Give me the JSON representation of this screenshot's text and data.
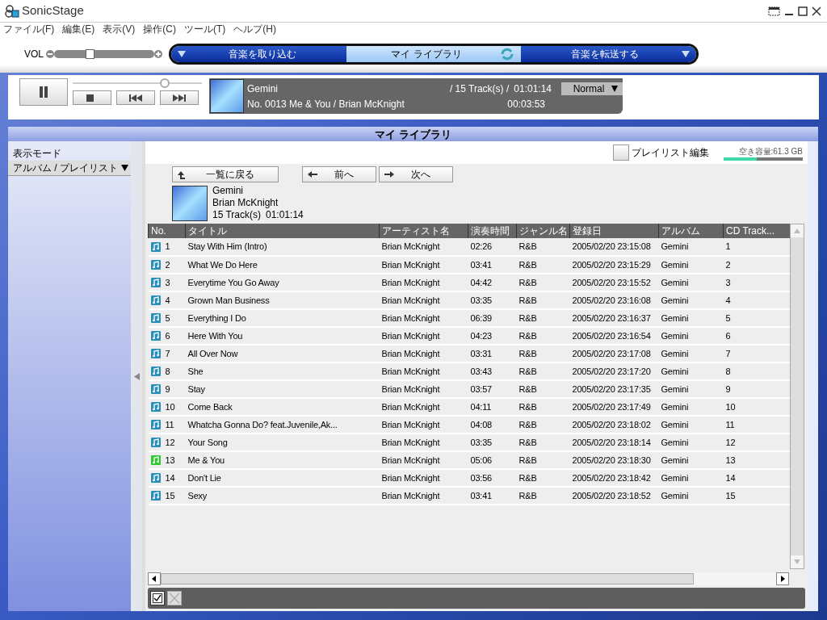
{
  "window": {
    "title": "SonicStage"
  },
  "menu": [
    "ファイル(F)",
    "編集(E)",
    "表示(V)",
    "操作(C)",
    "ツール(T)",
    "ヘルプ(H)"
  ],
  "volume": {
    "label": "VOL",
    "level": 0.35
  },
  "mode_tabs": [
    {
      "label": "音楽を取り込む",
      "selected": false
    },
    {
      "label": "マイ ライブラリ",
      "selected": true
    },
    {
      "label": "音楽を転送する",
      "selected": false
    }
  ],
  "player": {
    "seek": {
      "level": 0.73
    },
    "album": "Gemini",
    "track_count": "/ 15 Track(s)  /",
    "total_time": "01:01:14",
    "now_playing": "No. 0013   Me & You / Brian McKnight",
    "elapsed": "00:03:53",
    "play_mode": "Normal"
  },
  "library": {
    "title": "マイ ライブラリ",
    "view_mode_label": "表示モード",
    "view_mode": "アルバム / プレイリスト",
    "playlist_edit": {
      "label": "プレイリスト編集",
      "checked": false
    },
    "free_space": {
      "label": "空き容量:61.3 GB",
      "level": 0.42
    },
    "nav_buttons": [
      {
        "kind": "up",
        "label": "一覧に戻る"
      },
      {
        "kind": "back",
        "label": "前へ"
      },
      {
        "kind": "forward",
        "label": "次へ"
      }
    ],
    "album": {
      "title": "Gemini",
      "artist": "Brian McKnight",
      "tracks": "15 Track(s)",
      "duration": "01:01:14"
    },
    "table": {
      "columns": [
        "No.",
        "タイトル",
        "アーティスト名",
        "演奏時間",
        "ジャンル名",
        "登録日",
        "アルバム",
        "CD Track..."
      ],
      "rows": [
        {
          "no": "1",
          "title": "Stay With Him (Intro)",
          "artist": "Brian McKnight",
          "time": "02:26",
          "genre": "R&B",
          "added": "2005/02/20 23:15:08",
          "album": "Gemini",
          "cd_track": "1",
          "playing": false
        },
        {
          "no": "2",
          "title": "What We Do Here",
          "artist": "Brian McKnight",
          "time": "03:41",
          "genre": "R&B",
          "added": "2005/02/20 23:15:29",
          "album": "Gemini",
          "cd_track": "2",
          "playing": false
        },
        {
          "no": "3",
          "title": "Everytime You Go Away",
          "artist": "Brian McKnight",
          "time": "04:42",
          "genre": "R&B",
          "added": "2005/02/20 23:15:52",
          "album": "Gemini",
          "cd_track": "3",
          "playing": false
        },
        {
          "no": "4",
          "title": "Grown Man Business",
          "artist": "Brian McKnight",
          "time": "03:35",
          "genre": "R&B",
          "added": "2005/02/20 23:16:08",
          "album": "Gemini",
          "cd_track": "4",
          "playing": false
        },
        {
          "no": "5",
          "title": "Everything I Do",
          "artist": "Brian McKnight",
          "time": "06:39",
          "genre": "R&B",
          "added": "2005/02/20 23:16:37",
          "album": "Gemini",
          "cd_track": "5",
          "playing": false
        },
        {
          "no": "6",
          "title": "Here With You",
          "artist": "Brian McKnight",
          "time": "04:23",
          "genre": "R&B",
          "added": "2005/02/20 23:16:54",
          "album": "Gemini",
          "cd_track": "6",
          "playing": false
        },
        {
          "no": "7",
          "title": "All Over Now",
          "artist": "Brian McKnight",
          "time": "03:31",
          "genre": "R&B",
          "added": "2005/02/20 23:17:08",
          "album": "Gemini",
          "cd_track": "7",
          "playing": false
        },
        {
          "no": "8",
          "title": "She",
          "artist": "Brian McKnight",
          "time": "03:43",
          "genre": "R&B",
          "added": "2005/02/20 23:17:20",
          "album": "Gemini",
          "cd_track": "8",
          "playing": false
        },
        {
          "no": "9",
          "title": "Stay",
          "artist": "Brian McKnight",
          "time": "03:57",
          "genre": "R&B",
          "added": "2005/02/20 23:17:35",
          "album": "Gemini",
          "cd_track": "9",
          "playing": false
        },
        {
          "no": "10",
          "title": "Come Back",
          "artist": "Brian McKnight",
          "time": "04:11",
          "genre": "R&B",
          "added": "2005/02/20 23:17:49",
          "album": "Gemini",
          "cd_track": "10",
          "playing": false
        },
        {
          "no": "11",
          "title": "Whatcha Gonna Do? feat.Juvenile,Ak...",
          "artist": "Brian McKnight",
          "time": "04:08",
          "genre": "R&B",
          "added": "2005/02/20 23:18:02",
          "album": "Gemini",
          "cd_track": "11",
          "playing": false
        },
        {
          "no": "12",
          "title": "Your Song",
          "artist": "Brian McKnight",
          "time": "03:35",
          "genre": "R&B",
          "added": "2005/02/20 23:18:14",
          "album": "Gemini",
          "cd_track": "12",
          "playing": false
        },
        {
          "no": "13",
          "title": "Me & You",
          "artist": "Brian McKnight",
          "time": "05:06",
          "genre": "R&B",
          "added": "2005/02/20 23:18:30",
          "album": "Gemini",
          "cd_track": "13",
          "playing": true
        },
        {
          "no": "14",
          "title": "Don't Lie",
          "artist": "Brian McKnight",
          "time": "03:56",
          "genre": "R&B",
          "added": "2005/02/20 23:18:42",
          "album": "Gemini",
          "cd_track": "14",
          "playing": false
        },
        {
          "no": "15",
          "title": "Sexy",
          "artist": "Brian McKnight",
          "time": "03:41",
          "genre": "R&B",
          "added": "2005/02/20 23:18:52",
          "album": "Gemini",
          "cd_track": "15",
          "playing": false
        }
      ]
    }
  }
}
